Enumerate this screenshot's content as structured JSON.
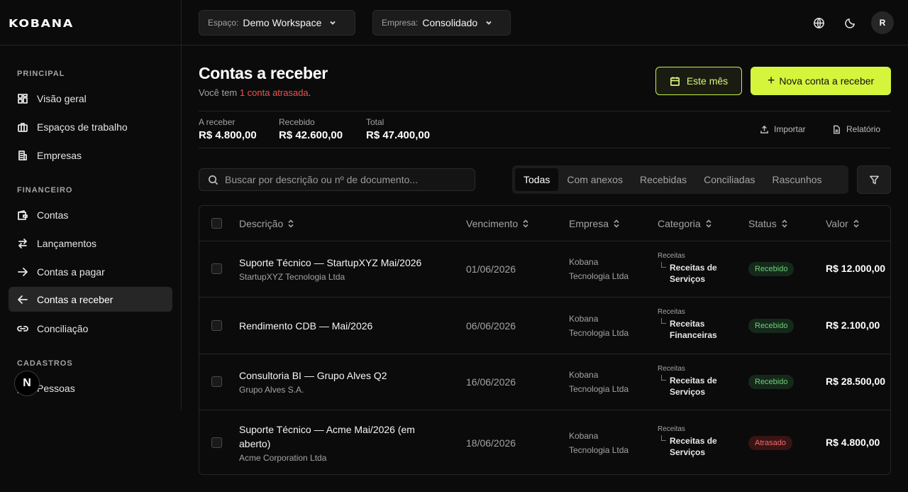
{
  "sidebar": {
    "logo": "KOBANA",
    "sections": {
      "principal": "PRINCIPAL",
      "financeiro": "FINANCEIRO",
      "cadastros": "CADASTROS"
    },
    "items": {
      "visao_geral": "Visão geral",
      "espacos": "Espaços de trabalho",
      "empresas": "Empresas",
      "contas": "Contas",
      "lancamentos": "Lançamentos",
      "contas_pagar": "Contas a pagar",
      "contas_receber": "Contas a receber",
      "conciliacao": "Conciliação",
      "pessoas": "Pessoas"
    },
    "badge": "N"
  },
  "topbar": {
    "space_label": "Espaço:",
    "space_value": "Demo Workspace",
    "company_label": "Empresa:",
    "company_value": "Consolidado",
    "avatar": "R"
  },
  "page": {
    "title": "Contas a receber",
    "subtitle_prefix": "Você tem ",
    "subtitle_late": "1 conta atrasada",
    "subtitle_suffix": ".",
    "period_button": "Este mês",
    "new_button": "Nova conta a receber"
  },
  "stats": [
    {
      "label": "A receber",
      "value": "R$ 4.800,00"
    },
    {
      "label": "Recebido",
      "value": "R$ 42.600,00"
    },
    {
      "label": "Total",
      "value": "R$ 47.400,00"
    }
  ],
  "actions": {
    "import": "Importar",
    "report": "Relatório"
  },
  "search": {
    "placeholder": "Buscar por descrição ou nº de documento..."
  },
  "tabs": [
    "Todas",
    "Com anexos",
    "Recebidas",
    "Conciliadas",
    "Rascunhos"
  ],
  "table": {
    "headers": {
      "desc": "Descrição",
      "due": "Vencimento",
      "company": "Empresa",
      "category": "Categoria",
      "status": "Status",
      "value": "Valor"
    },
    "rows": [
      {
        "title": "Suporte Técnico — StartupXYZ Mai/2026",
        "sub": "StartupXYZ Tecnologia Ltda",
        "due": "01/06/2026",
        "company_1": "Kobana",
        "company_2": "Tecnologia Ltda",
        "cat_parent": "Receitas",
        "cat_1": "Receitas de",
        "cat_2": "Serviços",
        "status": "Recebido",
        "value": "R$ 12.000,00"
      },
      {
        "title": "Rendimento CDB — Mai/2026",
        "sub": "",
        "due": "06/06/2026",
        "company_1": "Kobana",
        "company_2": "Tecnologia Ltda",
        "cat_parent": "Receitas",
        "cat_1": "Receitas",
        "cat_2": "Financeiras",
        "status": "Recebido",
        "value": "R$ 2.100,00"
      },
      {
        "title": "Consultoria BI — Grupo Alves Q2",
        "sub": "Grupo Alves S.A.",
        "due": "16/06/2026",
        "company_1": "Kobana",
        "company_2": "Tecnologia Ltda",
        "cat_parent": "Receitas",
        "cat_1": "Receitas de",
        "cat_2": "Serviços",
        "status": "Recebido",
        "value": "R$ 28.500,00"
      },
      {
        "title_1": "Suporte Técnico — Acme Mai/2026 (em",
        "title_2": "aberto)",
        "sub": "Acme Corporation Ltda",
        "due": "18/06/2026",
        "company_1": "Kobana",
        "company_2": "Tecnologia Ltda",
        "cat_parent": "Receitas",
        "cat_1": "Receitas de",
        "cat_2": "Serviços",
        "status": "Atrasado",
        "value": "R$ 4.800,00"
      }
    ]
  },
  "colors": {
    "accent": "#d4f53c",
    "background": "#0b0b0b",
    "late": "#f05252",
    "success": "#6fcf7b"
  }
}
